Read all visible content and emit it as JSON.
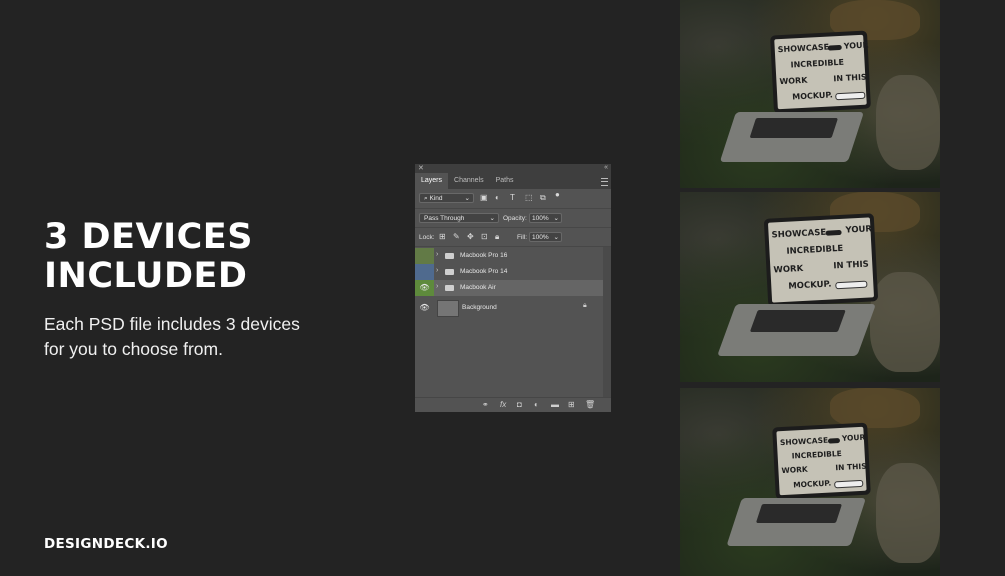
{
  "headline": {
    "line1": "3 DEVICES",
    "line2": "INCLUDED"
  },
  "subtitle": {
    "line1": "Each PSD file includes 3 devices",
    "line2": "for you to choose from."
  },
  "brand": "DESIGNDECK.IO",
  "panel": {
    "tabs": [
      "Layers",
      "Channels",
      "Paths"
    ],
    "filter_kind": "Kind",
    "blend_mode": "Pass Through",
    "opacity_label": "Opacity:",
    "opacity_value": "100%",
    "lock_label": "Lock:",
    "fill_label": "Fill:",
    "fill_value": "100%",
    "layers": [
      {
        "name": "Macbook Pro 16",
        "color": "#627a46",
        "visible": false,
        "selected": false
      },
      {
        "name": "Macbook Pro 14",
        "color": "#4f6a8e",
        "visible": false,
        "selected": false
      },
      {
        "name": "Macbook Air",
        "color": "#5e8a3c",
        "visible": true,
        "selected": true
      }
    ],
    "background_layer": "Background"
  },
  "mockup_screen": {
    "w1": "SHOWCASE",
    "w2": "YOUR",
    "w3": "INCREDIBLE",
    "w4": "WORK",
    "w5": "IN THIS",
    "w6": "MOCKUP."
  }
}
